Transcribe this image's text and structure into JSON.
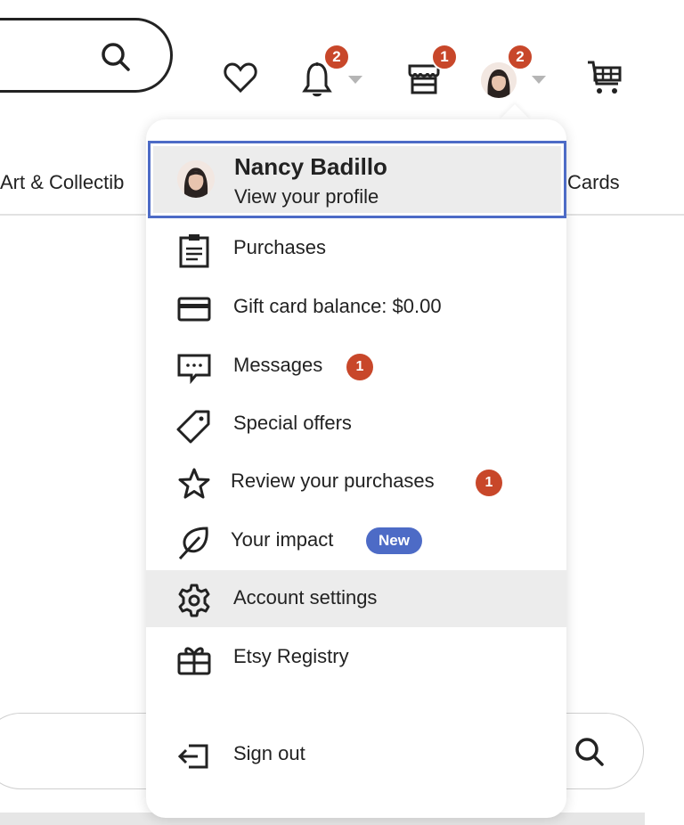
{
  "header": {
    "search_icon": "search-icon",
    "favorites_icon": "heart-icon",
    "notifications": {
      "icon": "bell-icon",
      "badge": "2"
    },
    "shop_manager": {
      "icon": "shop-icon",
      "badge": "1"
    },
    "account": {
      "icon": "avatar",
      "badge": "2"
    },
    "cart_icon": "cart-icon"
  },
  "categories": {
    "left_partial": "Art & Collectib",
    "right_partial": "Cards"
  },
  "account_menu": {
    "profile": {
      "name": "Nancy Badillo",
      "subtitle": "View your profile"
    },
    "items": [
      {
        "label": "Purchases",
        "icon": "clipboard-icon"
      },
      {
        "label": "Gift card balance: $0.00",
        "icon": "credit-card-icon"
      },
      {
        "label": "Messages",
        "icon": "message-icon",
        "badge": "1"
      },
      {
        "label": "Special offers",
        "icon": "tag-icon"
      },
      {
        "label": "Review your purchases",
        "icon": "star-icon",
        "badge": "1"
      },
      {
        "label": "Your impact",
        "icon": "leaf-icon",
        "pill": "New"
      },
      {
        "label": "Account settings",
        "icon": "gear-icon",
        "highlighted": true
      },
      {
        "label": "Etsy Registry",
        "icon": "gift-icon"
      },
      {
        "label": "Sign out",
        "icon": "sign-out-icon"
      }
    ]
  },
  "colors": {
    "badge": "#c8472a",
    "accent": "#4d6bc6",
    "hover": "#ececec"
  }
}
